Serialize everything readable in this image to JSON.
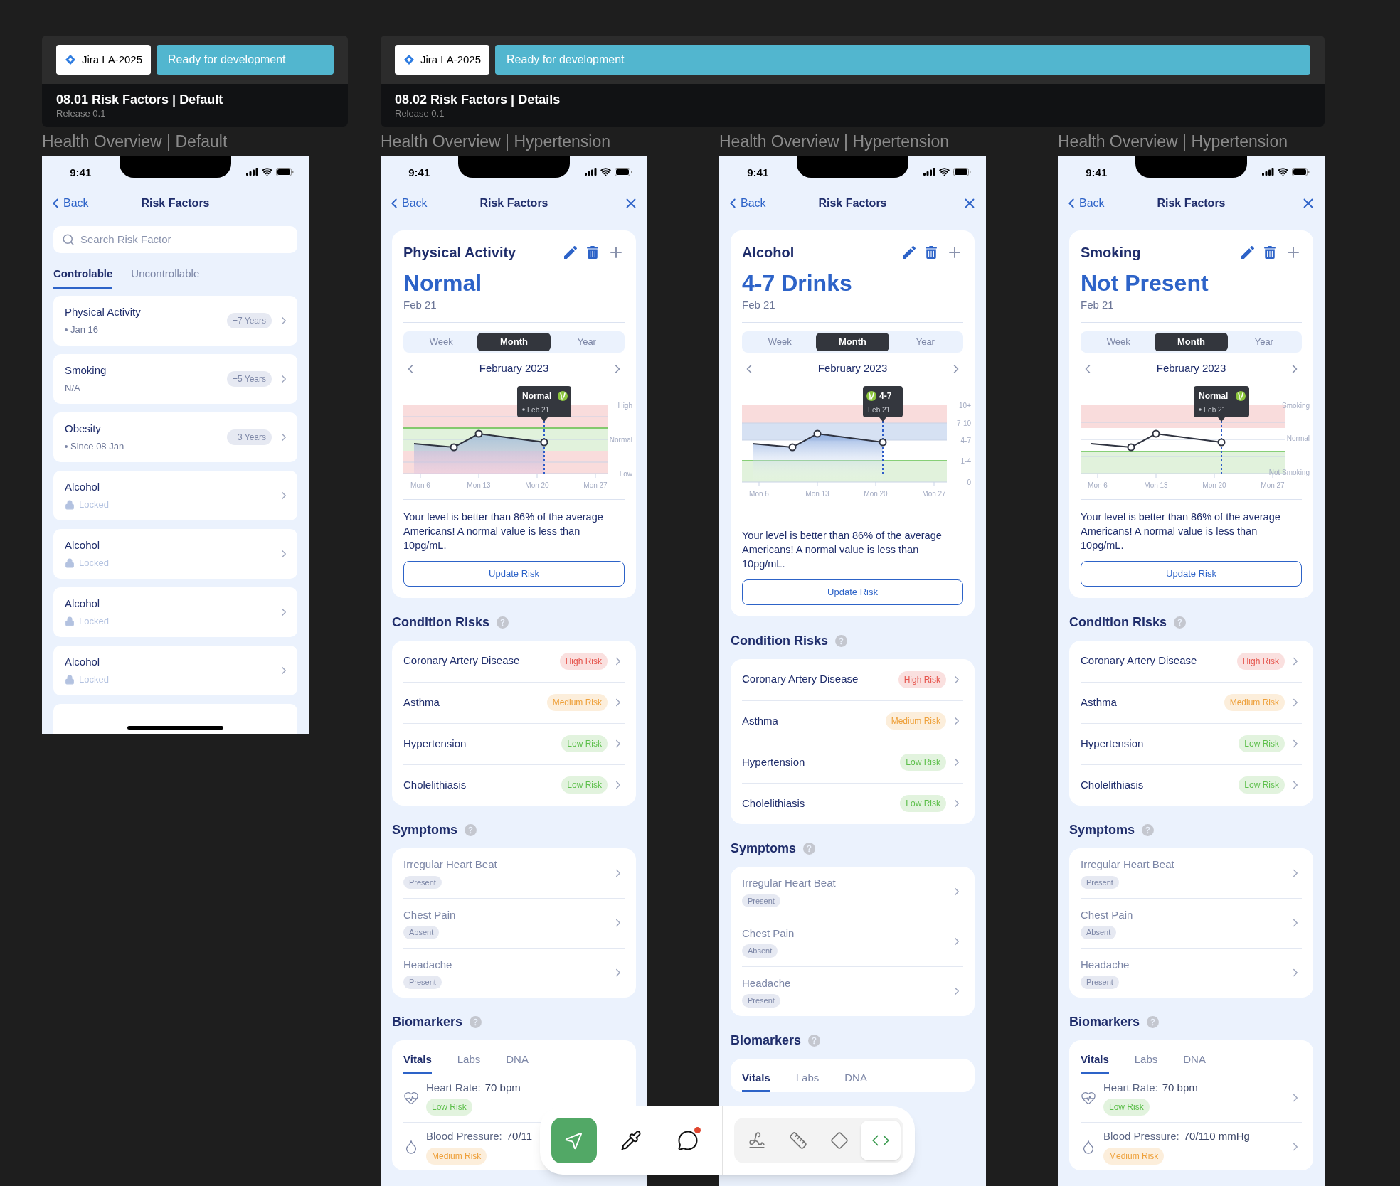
{
  "headers": [
    {
      "ticket": "Jira LA-2025",
      "status": "Ready for development",
      "title": "08.01 Risk Factors | Default",
      "release": "Release 0.1"
    },
    {
      "ticket": "Jira LA-2025",
      "status": "Ready for development",
      "title": "08.02 Risk Factors | Details",
      "release": "Release 0.1"
    }
  ],
  "screens": [
    {
      "kind": "list",
      "caption": "Health Overview | Default",
      "time": "9:41",
      "back": "Back",
      "title": "Risk Factors",
      "search": {
        "placeholder": "Search Risk Factor"
      },
      "tabs": [
        {
          "label": "Controlable",
          "selected": true
        },
        {
          "label": "Uncontrollable",
          "selected": false
        }
      ],
      "items": [
        {
          "kind": "dated",
          "name": "Physical Activity",
          "note": "Jan 16",
          "badge": "+7 Years"
        },
        {
          "kind": "plain",
          "name": "Smoking",
          "note": "N/A",
          "badge": "+5 Years"
        },
        {
          "kind": "dated",
          "name": "Obesity",
          "note": "Since 08 Jan",
          "badge": "+3 Years"
        },
        {
          "kind": "locked",
          "name": "Alcohol",
          "note": "Locked"
        },
        {
          "kind": "locked",
          "name": "Alcohol",
          "note": "Locked"
        },
        {
          "kind": "locked",
          "name": "Alcohol",
          "note": "Locked"
        },
        {
          "kind": "locked",
          "name": "Alcohol",
          "note": "Locked"
        }
      ]
    },
    {
      "kind": "detail",
      "caption": "Health Overview | Hypertension",
      "time": "9:41",
      "back": "Back",
      "title": "Risk Factors",
      "factor": {
        "name": "Physical Activity",
        "value": "Normal",
        "date": "Feb 21",
        "periods": [
          {
            "label": "Week",
            "selected": false
          },
          {
            "label": "Month",
            "selected": true
          },
          {
            "label": "Year",
            "selected": false
          }
        ],
        "month": "February 2023",
        "chart": {
          "kind": "range",
          "y_labels": [
            "High",
            "Normal",
            "Low"
          ],
          "x_labels": [
            "Mon 6",
            "Mon 13",
            "Mon 20",
            "Mon 27"
          ],
          "tooltip": {
            "value": "Normal",
            "date": "Feb 21"
          }
        },
        "message": "Your level is better than 86% of the average Americans! A normal value is less than 10pg/mL.",
        "action": "Update Risk"
      },
      "sections": [
        {
          "kind": "conditions",
          "title": "Condition Risks",
          "items": [
            {
              "name": "Coronary Artery Disease",
              "color": "#e5534b",
              "badge": "High Risk"
            },
            {
              "name": "Asthma",
              "color": "#eea03a",
              "badge": "Medium Risk"
            },
            {
              "name": "Hypertension",
              "color": "#5cbf4a",
              "badge": "Low Risk"
            },
            {
              "name": "Cholelithiasis",
              "color": "#5cbf4a",
              "badge": "Low Risk"
            }
          ]
        },
        {
          "kind": "symptoms",
          "title": "Symptoms",
          "items": [
            {
              "name": "Irregular Heart Beat",
              "status": "Present"
            },
            {
              "name": "Chest Pain",
              "status": "Absent"
            },
            {
              "name": "Headache",
              "status": "Present"
            }
          ]
        },
        {
          "kind": "biomarkers",
          "title": "Biomarkers",
          "tabs": [
            {
              "label": "Vitals",
              "selected": true
            },
            {
              "label": "Labs",
              "selected": false
            },
            {
              "label": "DNA",
              "selected": false
            }
          ],
          "items": [
            {
              "kind": "heart",
              "label": "Heart Rate:",
              "value": "70 bpm",
              "color": "#5cbf4a",
              "badge": "Low Risk",
              "chevron": false
            },
            {
              "kind": "pressure",
              "label": "Blood Pressure:",
              "value": "70/11",
              "color": "#eea03a",
              "badge": "Medium Risk",
              "chevron": false
            }
          ]
        }
      ]
    },
    {
      "kind": "detail",
      "caption": "Health Overview | Hypertension",
      "time": "9:41",
      "back": "Back",
      "title": "Risk Factors",
      "factor": {
        "name": "Alcohol",
        "value": "4-7 Drinks",
        "date": "Feb 21",
        "periods": [
          {
            "label": "Week",
            "selected": false
          },
          {
            "label": "Month",
            "selected": true
          },
          {
            "label": "Year",
            "selected": false
          }
        ],
        "month": "February 2023",
        "chart": {
          "kind": "drinks",
          "y_labels": [
            "10+",
            "7-10",
            "4-7",
            "1-4",
            "0"
          ],
          "x_labels": [
            "Mon 6",
            "Mon 13",
            "Mon 20",
            "Mon 27"
          ],
          "tooltip": {
            "value": "4-7",
            "date": "Feb 21"
          }
        },
        "message": "Your level is better than 86% of the average Americans! A normal value is less than 10pg/mL.",
        "action": "Update Risk"
      },
      "sections": [
        {
          "kind": "conditions",
          "title": "Condition Risks",
          "items": [
            {
              "name": "Coronary Artery Disease",
              "color": "#e5534b",
              "badge": "High Risk"
            },
            {
              "name": "Asthma",
              "color": "#eea03a",
              "badge": "Medium Risk"
            },
            {
              "name": "Hypertension",
              "color": "#5cbf4a",
              "badge": "Low Risk"
            },
            {
              "name": "Cholelithiasis",
              "color": "#5cbf4a",
              "badge": "Low Risk"
            }
          ]
        },
        {
          "kind": "symptoms",
          "title": "Symptoms",
          "items": [
            {
              "name": "Irregular Heart Beat",
              "status": "Present"
            },
            {
              "name": "Chest Pain",
              "status": "Absent"
            },
            {
              "name": "Headache",
              "status": "Present"
            }
          ]
        },
        {
          "kind": "biomarkers",
          "title": "Biomarkers",
          "tabs": [
            {
              "label": "Vitals",
              "selected": true
            },
            {
              "label": "Labs",
              "selected": false
            },
            {
              "label": "DNA",
              "selected": false
            }
          ]
        }
      ]
    },
    {
      "kind": "detail",
      "caption": "Health Overview | Hypertension",
      "time": "9:41",
      "back": "Back",
      "title": "Risk Factors",
      "factor": {
        "name": "Smoking",
        "value": "Not Present",
        "date": "Feb 21",
        "periods": [
          {
            "label": "Week",
            "selected": false
          },
          {
            "label": "Month",
            "selected": true
          },
          {
            "label": "Year",
            "selected": false
          }
        ],
        "month": "February 2023",
        "chart": {
          "kind": "smoking",
          "y_labels": [
            "Smoking",
            "Normal",
            "Not Smoking"
          ],
          "x_labels": [
            "Mon 6",
            "Mon 13",
            "Mon 20",
            "Mon 27"
          ],
          "tooltip": {
            "value": "Normal",
            "date": "Feb 21"
          }
        },
        "message": "Your level is better than 86% of the average Americans! A normal value is less than 10pg/mL.",
        "action": "Update Risk"
      },
      "sections": [
        {
          "kind": "conditions",
          "title": "Condition Risks",
          "items": [
            {
              "name": "Coronary Artery Disease",
              "color": "#e5534b",
              "badge": "High Risk"
            },
            {
              "name": "Asthma",
              "color": "#eea03a",
              "badge": "Medium Risk"
            },
            {
              "name": "Hypertension",
              "color": "#5cbf4a",
              "badge": "Low Risk"
            },
            {
              "name": "Cholelithiasis",
              "color": "#5cbf4a",
              "badge": "Low Risk"
            }
          ]
        },
        {
          "kind": "symptoms",
          "title": "Symptoms",
          "items": [
            {
              "name": "Irregular Heart Beat",
              "status": "Present"
            },
            {
              "name": "Chest Pain",
              "status": "Absent"
            },
            {
              "name": "Headache",
              "status": "Present"
            }
          ]
        },
        {
          "kind": "biomarkers",
          "title": "Biomarkers",
          "tabs": [
            {
              "label": "Vitals",
              "selected": true
            },
            {
              "label": "Labs",
              "selected": false
            },
            {
              "label": "DNA",
              "selected": false
            }
          ],
          "items": [
            {
              "kind": "heart",
              "label": "Heart Rate:",
              "value": "70 bpm",
              "color": "#5cbf4a",
              "badge": "Low Risk",
              "chevron": true
            },
            {
              "kind": "pressure",
              "label": "Blood Pressure:",
              "value": "70/110 mmHg",
              "color": "#eea03a",
              "badge": "Medium Risk",
              "chevron": true
            }
          ]
        }
      ]
    }
  ],
  "toolbar": {
    "tools": [
      {
        "kind": "pointer",
        "selected": true
      },
      {
        "kind": "eyedropper",
        "selected": false
      },
      {
        "kind": "comment",
        "selected": false,
        "unread": true
      }
    ],
    "modes": [
      {
        "kind": "draw",
        "selected": false
      },
      {
        "kind": "measure",
        "selected": false
      },
      {
        "kind": "component",
        "selected": false
      },
      {
        "kind": "code",
        "selected": true
      }
    ]
  }
}
